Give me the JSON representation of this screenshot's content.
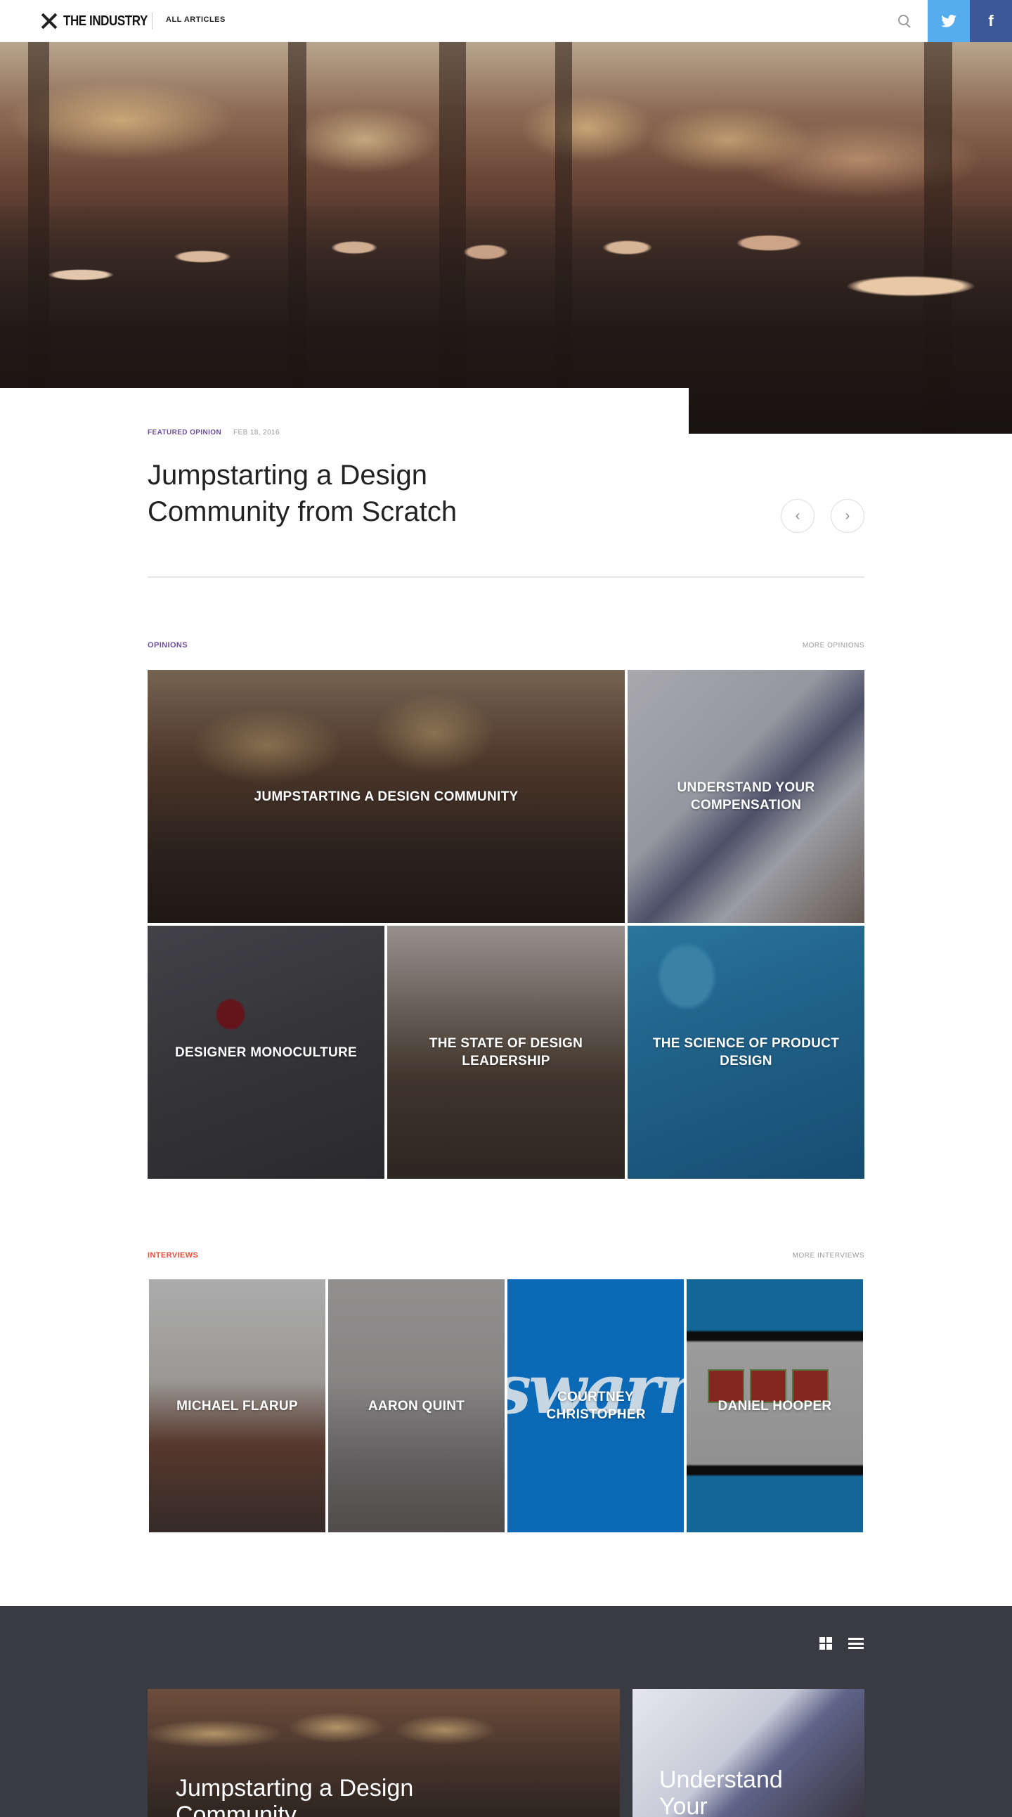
{
  "header": {
    "logo_text": "THE INDUSTRY",
    "nav_all": "ALL ARTICLES",
    "twitter_icon": "twitter-icon",
    "facebook_label": "f"
  },
  "featured": {
    "category": "FEATURED OPINION",
    "date": "FEB 18, 2016",
    "title": "Jumpstarting a Design Community from Scratch",
    "prev_arrow": "‹",
    "next_arrow": "›"
  },
  "opinions": {
    "label": "OPINIONS",
    "more": "MORE OPINIONS",
    "tiles": [
      "JUMPSTARTING A DESIGN COMMUNITY",
      "UNDERSTAND YOUR COMPENSATION",
      "DESIGNER MONOCULTURE",
      "THE STATE OF DESIGN LEADERSHIP",
      "THE SCIENCE OF PRODUCT DESIGN"
    ]
  },
  "interviews": {
    "label": "INTERVIEWS",
    "more": "MORE INTERVIEWS",
    "tiles": [
      "MICHAEL FLARUP",
      "AARON QUINT",
      "COURTNEY CHRISTOPHER",
      "DANIEL HOOPER"
    ]
  },
  "feed": {
    "cards": [
      "Jumpstarting a Design Community",
      "Understand Your"
    ]
  },
  "colors": {
    "opinion_accent": "#6b4e9b",
    "interview_accent": "#e8513a",
    "twitter": "#55acee",
    "facebook": "#3b5998",
    "dark_section": "#3a3a42"
  }
}
